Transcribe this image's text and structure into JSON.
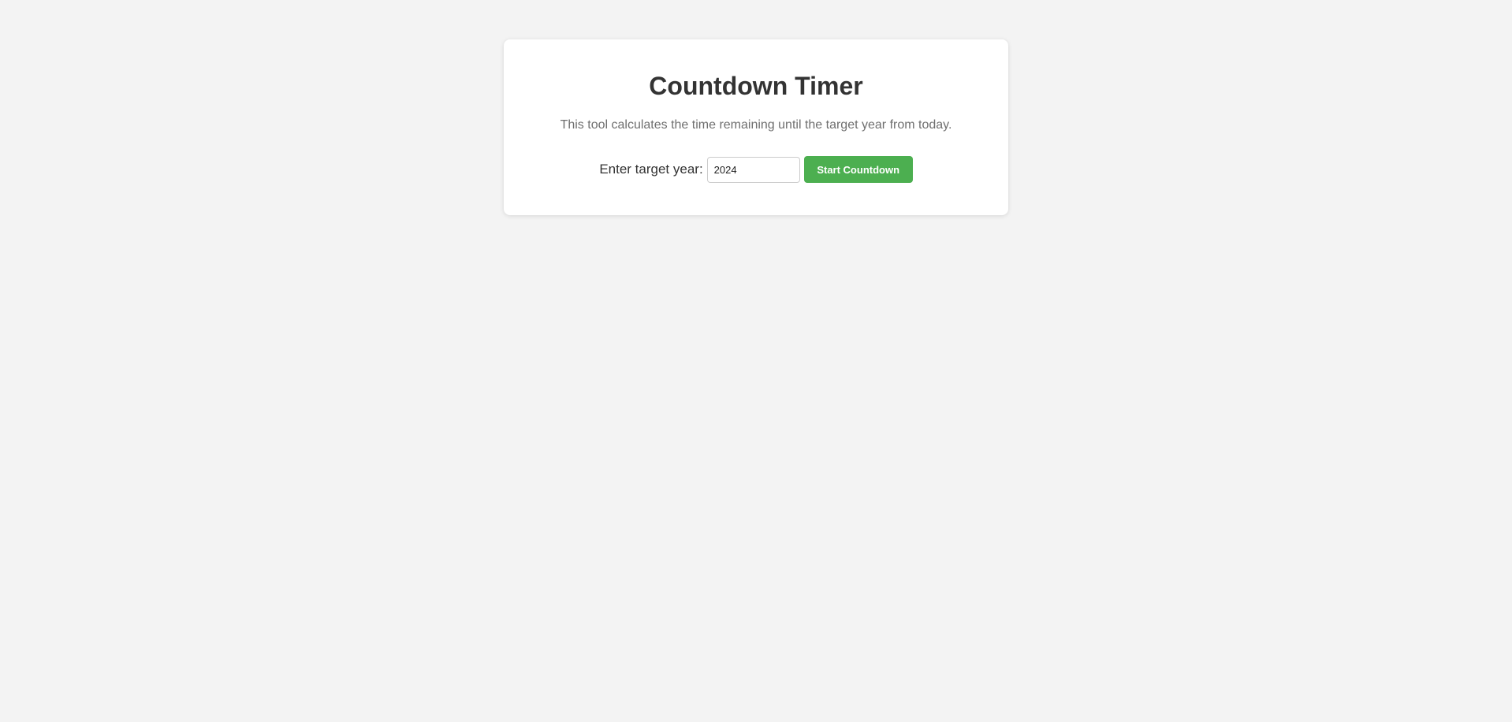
{
  "card": {
    "title": "Countdown Timer",
    "subtitle": "This tool calculates the time remaining until the target year from today."
  },
  "form": {
    "label": "Enter target year:",
    "year_value": "2024",
    "start_button_label": "Start Countdown"
  },
  "colors": {
    "page_background": "#f3f3f3",
    "card_background": "#ffffff",
    "accent": "#4caf50",
    "title_text": "#333333",
    "subtitle_text": "#6f6f6f"
  }
}
